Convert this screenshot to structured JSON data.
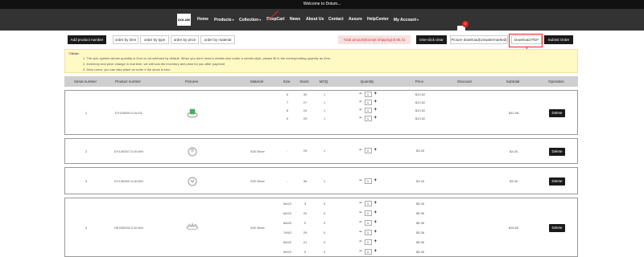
{
  "welcome": "Welcome to Dolum...",
  "logo": "DOLUM",
  "nav": {
    "items": [
      {
        "label": "Home",
        "caret": false
      },
      {
        "label": "Products",
        "caret": true
      },
      {
        "label": "Collection",
        "caret": true
      },
      {
        "label": "ShopCart",
        "caret": false
      },
      {
        "label": "News",
        "caret": false
      },
      {
        "label": "About Us",
        "caret": false
      },
      {
        "label": "Contact",
        "caret": false
      },
      {
        "label": "Assure",
        "caret": false
      },
      {
        "label": "HelpCenter",
        "caret": false
      },
      {
        "label": "My Account",
        "caret": true
      }
    ],
    "cart_count": "0"
  },
  "toolbar": {
    "add_label": "Add product number",
    "sort_time": "order by time",
    "sort_type": "order by type",
    "sort_price": "order by price",
    "sort_material": "order by material",
    "total": "Total amount(Except shipping):$ 95.41",
    "one_click_clear": "One-click clear",
    "picture_download": "Picture download(Unwatermarked)",
    "download_pdf": "Download PDF",
    "submit_order": "Submit Order"
  },
  "note": {
    "title": "Note:",
    "lines": [
      "1. The size system whose quantity is Zero is not selected by default. When you don't need a certain size under a certain style, please fill in the corresponding quantity as Zero",
      "2. Inventory and price change in real time, we will lock the inventory and price for you after payment",
      "3. Dear users, you can also place an order if the stock is zero"
    ]
  },
  "table": {
    "headers": [
      "Serial number",
      "Product number",
      "Pictures",
      "Material",
      "Size",
      "Stock",
      "MOQ",
      "Quantity",
      "Price",
      "Discount",
      "Subtotal",
      "Operation"
    ],
    "delete_label": "Delete",
    "rows": [
      {
        "serial": "1",
        "product": "DY100099-S-W-DL",
        "material": "",
        "subtotal": "$42.08",
        "lines": [
          {
            "size": "6",
            "stock": "30",
            "moq": "1",
            "qty": "1",
            "price": "$10.52"
          },
          {
            "size": "7",
            "stock": "27",
            "moq": "1",
            "qty": "1",
            "price": "$10.52"
          },
          {
            "size": "8",
            "stock": "24",
            "moq": "1",
            "qty": "1",
            "price": "$10.52"
          },
          {
            "size": "9",
            "stock": "25",
            "moq": "1",
            "qty": "1",
            "price": "$10.52"
          }
        ]
      },
      {
        "serial": "2",
        "product": "DY100057-S-W-WH",
        "material": "925 Silver",
        "subtotal": "$3.45",
        "lines": [
          {
            "size": "-",
            "stock": "25",
            "moq": "1",
            "qty": "1",
            "price": "$3.45"
          }
        ]
      },
      {
        "serial": "3",
        "product": "DY100062-S-W-WH",
        "material": "925 Silver",
        "subtotal": "$3.45",
        "lines": [
          {
            "size": "-",
            "stock": "36",
            "moq": "1",
            "qty": "1",
            "price": "$3.45"
          }
        ]
      },
      {
        "serial": "4",
        "product": "HE200003-S-W-WH",
        "material": "925 Silver",
        "subtotal": "$26.80",
        "lines": [
          {
            "size": "5#US",
            "stock": "3",
            "moq": "0",
            "qty": "1",
            "price": "$5.36"
          },
          {
            "size": "6#US",
            "stock": "20",
            "moq": "0",
            "qty": "1",
            "price": "$5.36"
          },
          {
            "size": "6#US",
            "stock": "0",
            "moq": "0",
            "qty": "1",
            "price": "$5.36"
          },
          {
            "size": "7#US",
            "stock": "25",
            "moq": "0",
            "qty": "1",
            "price": "$5.36"
          },
          {
            "size": "8#US",
            "stock": "21",
            "moq": "0",
            "qty": "1",
            "price": "$5.36"
          },
          {
            "size": "9#US",
            "stock": "9",
            "moq": "0",
            "qty": "1",
            "price": "$5.36"
          }
        ]
      }
    ]
  },
  "colors": {
    "accent": "#e0271f",
    "dark": "#1a1a1a",
    "note_bg": "#fff9c4"
  }
}
